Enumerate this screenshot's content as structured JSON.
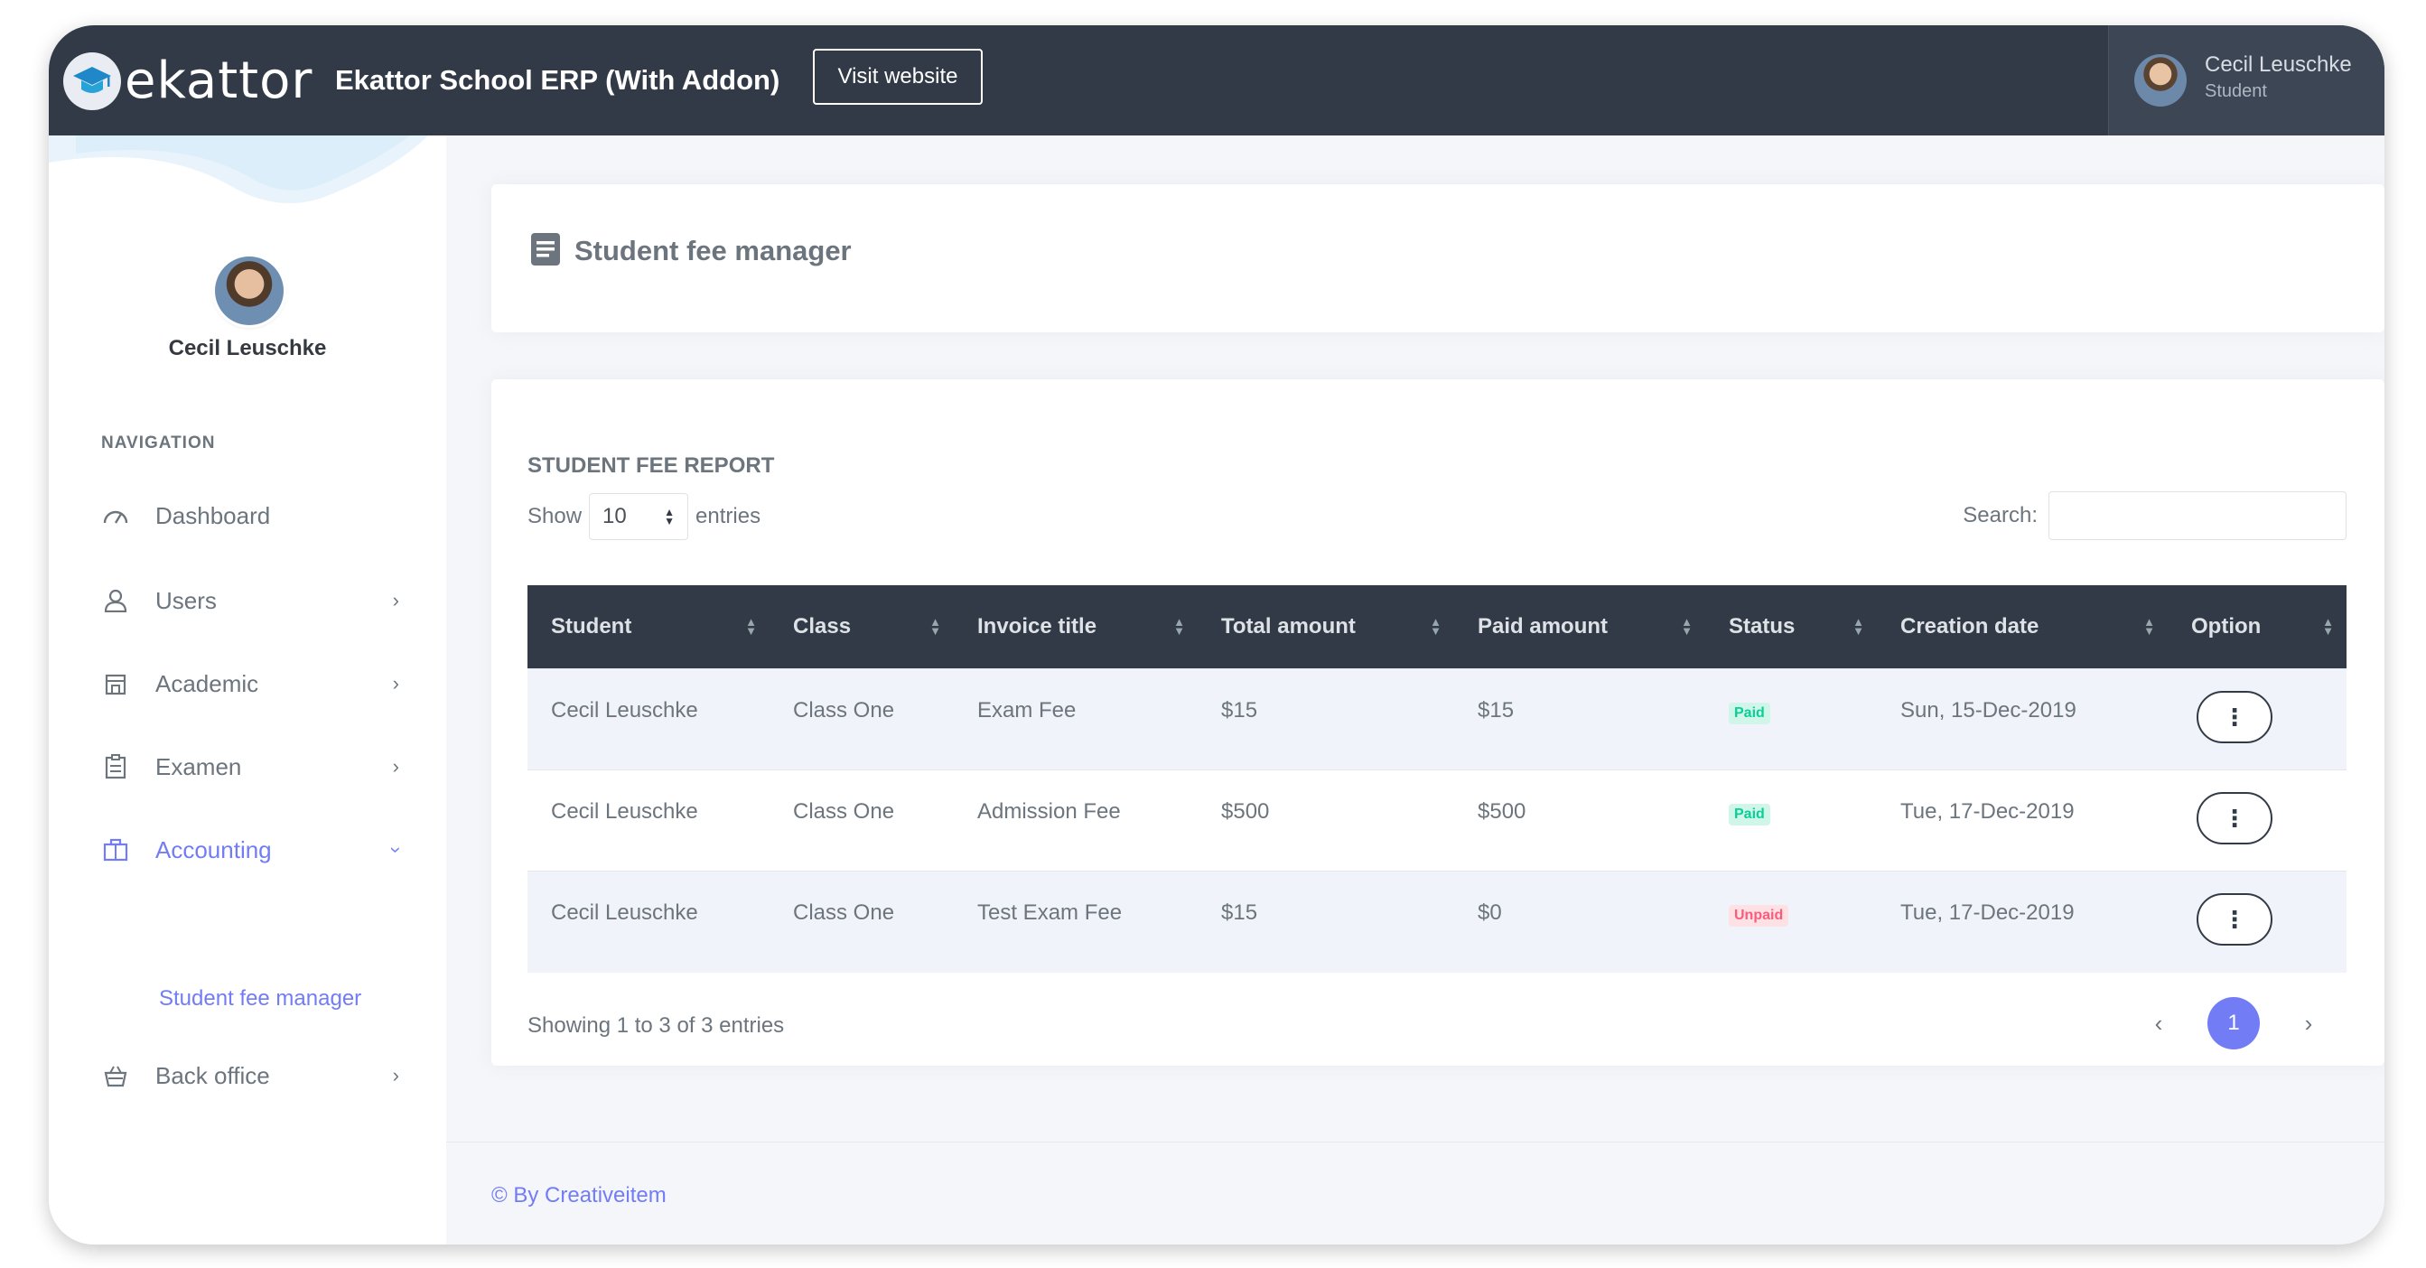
{
  "topbar": {
    "logo_text": "ekattor",
    "app_title": "Ekattor School ERP (With Addon)",
    "visit_button": "Visit website",
    "user_name": "Cecil Leuschke",
    "user_role": "Student"
  },
  "sidebar": {
    "profile_name": "Cecil Leuschke",
    "nav_title": "NAVIGATION",
    "items": [
      {
        "label": "Dashboard",
        "icon": "dashboard-gauge-icon"
      },
      {
        "label": "Users",
        "icon": "user-icon"
      },
      {
        "label": "Academic",
        "icon": "building-icon"
      },
      {
        "label": "Examen",
        "icon": "clipboard-icon"
      },
      {
        "label": "Accounting",
        "icon": "briefcase-icon",
        "active": true
      },
      {
        "label": "Back office",
        "icon": "basket-icon"
      }
    ],
    "sub_item": "Student fee manager"
  },
  "page": {
    "title": "Student fee manager"
  },
  "report": {
    "title": "STUDENT FEE REPORT",
    "show_label": "Show",
    "entries_value": "10",
    "entries_label": "entries",
    "search_label": "Search:",
    "search_value": "",
    "columns": [
      "Student",
      "Class",
      "Invoice title",
      "Total amount",
      "Paid amount",
      "Status",
      "Creation date",
      "Option"
    ],
    "rows": [
      {
        "student": "Cecil Leuschke",
        "class": "Class One",
        "invoice": "Exam Fee",
        "total": "$15",
        "paid": "$15",
        "status": "Paid",
        "date": "Sun, 15-Dec-2019"
      },
      {
        "student": "Cecil Leuschke",
        "class": "Class One",
        "invoice": "Admission Fee",
        "total": "$500",
        "paid": "$500",
        "status": "Paid",
        "date": "Tue, 17-Dec-2019"
      },
      {
        "student": "Cecil Leuschke",
        "class": "Class One",
        "invoice": "Test Exam Fee",
        "total": "$15",
        "paid": "$0",
        "status": "Unpaid",
        "date": "Tue, 17-Dec-2019"
      }
    ],
    "info": "Showing 1 to 3 of 3 entries",
    "current_page": "1",
    "prev_symbol": "‹",
    "next_symbol": "›"
  },
  "footer": {
    "text": "© By Creativeitem"
  },
  "colors": {
    "topbar": "#313a46",
    "accent": "#727cf5",
    "paid": "#0acf97",
    "unpaid": "#fa5c7c"
  }
}
